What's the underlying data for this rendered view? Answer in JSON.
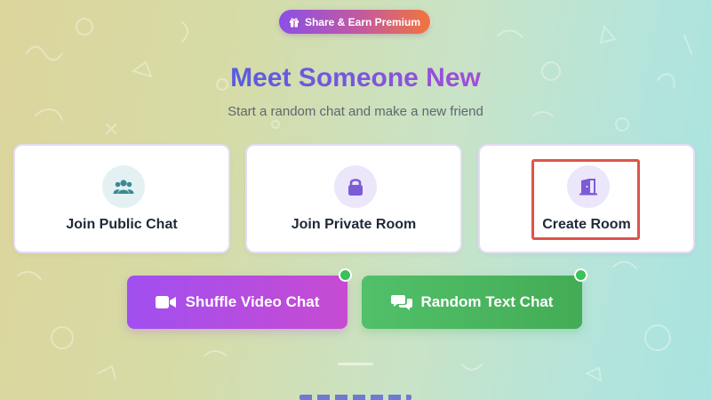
{
  "promo": {
    "label": "Share & Earn Premium",
    "icon": "gift-icon"
  },
  "hero": {
    "title": "Meet Someone New",
    "subtitle": "Start a random chat and make a new friend"
  },
  "options": [
    {
      "label": "Join Public Chat",
      "icon": "users-icon",
      "icon_color": "#3a8a95",
      "icon_bg": "#e4f1f3"
    },
    {
      "label": "Join Private Room",
      "icon": "lock-icon",
      "icon_color": "#7c5cd6",
      "icon_bg": "#ece6fa"
    },
    {
      "label": "Create Room",
      "icon": "door-open-icon",
      "icon_color": "#7c5cd6",
      "icon_bg": "#ece6fa",
      "highlighted": true
    }
  ],
  "actions": {
    "video": {
      "label": "Shuffle Video Chat",
      "icon": "video-camera-icon",
      "online": true
    },
    "text": {
      "label": "Random Text Chat",
      "icon": "chat-bubbles-icon",
      "online": true
    }
  },
  "colors": {
    "accent_purple": "#8b4fe8",
    "accent_green": "#43ac55",
    "highlight_red": "#e0524a",
    "online_green": "#39c15a"
  }
}
